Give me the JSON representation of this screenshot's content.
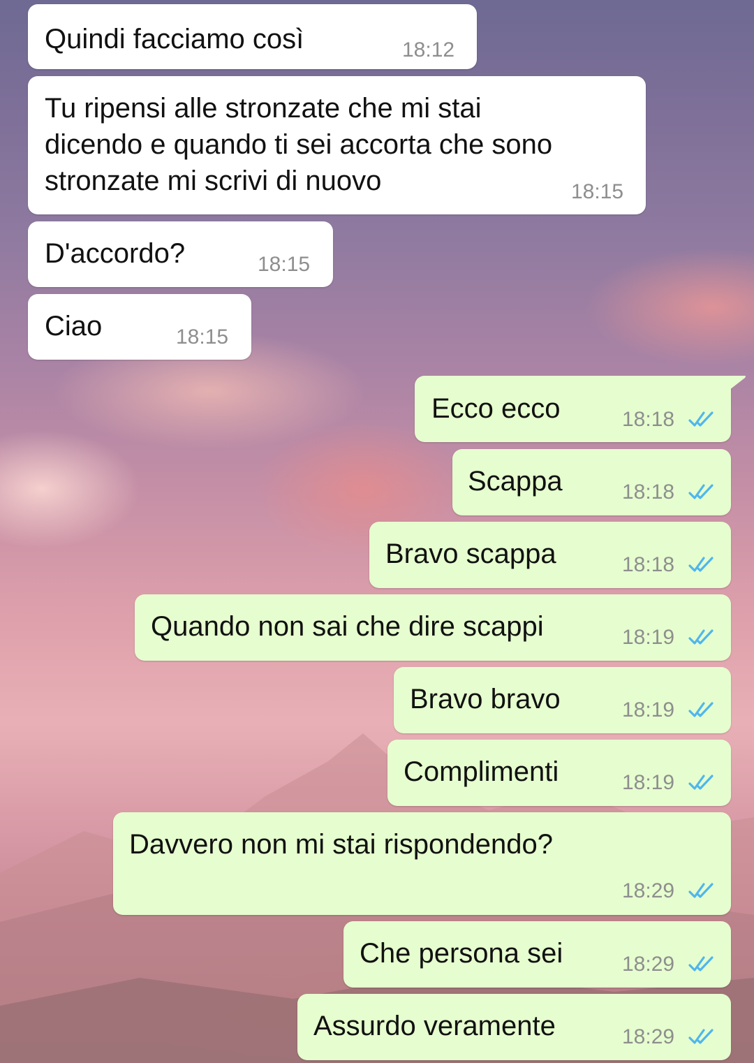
{
  "chat": {
    "incoming": [
      {
        "text_lines": [
          "Quindi facciamo così"
        ],
        "time": "18:12"
      },
      {
        "text_lines": [
          "Tu ripensi alle stronzate che mi stai",
          "dicendo e quando ti sei accorta che sono",
          "stronzate mi scrivi di nuovo"
        ],
        "time": "18:15"
      },
      {
        "text_lines": [
          "D'accordo?"
        ],
        "time": "18:15"
      },
      {
        "text_lines": [
          "Ciao"
        ],
        "time": "18:15"
      }
    ],
    "outgoing": [
      {
        "text": "Ecco ecco",
        "time": "18:18",
        "status": "read"
      },
      {
        "text": "Scappa",
        "time": "18:18",
        "status": "read"
      },
      {
        "text": "Bravo scappa",
        "time": "18:18",
        "status": "read"
      },
      {
        "text": "Quando non sai che dire scappi",
        "time": "18:19",
        "status": "read"
      },
      {
        "text": "Bravo bravo",
        "time": "18:19",
        "status": "read"
      },
      {
        "text": "Complimenti",
        "time": "18:19",
        "status": "read"
      },
      {
        "text": "Davvero non mi stai rispondendo?",
        "time": "18:29",
        "status": "read"
      },
      {
        "text": "Che persona sei",
        "time": "18:29",
        "status": "read"
      },
      {
        "text": "Assurdo veramente",
        "time": "18:29",
        "status": "read"
      }
    ]
  },
  "colors": {
    "incoming_bubble": "#ffffff",
    "outgoing_bubble": "#e6fecf",
    "read_ticks": "#4fb6ec",
    "timestamp": "#8e8e8e"
  },
  "icons": {
    "read_receipt": "double-check-icon"
  }
}
